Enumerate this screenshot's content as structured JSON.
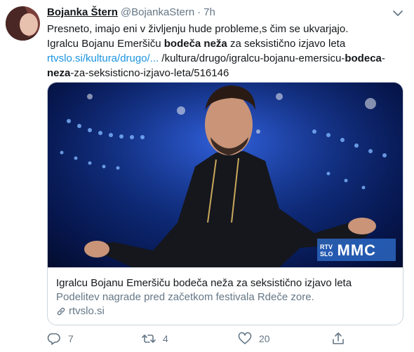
{
  "tweet": {
    "author_name": "Bojanka Štern",
    "author_handle": "@BojankaStern",
    "separator": "·",
    "time": "7h",
    "text_line1": "Presneto, imajo eni v življenju hude probleme,s čim se ukvarjajo.",
    "text_line2_pre": "Igralcu Bojanu Emeršiču ",
    "text_line2_bold": "bodeča neža",
    "text_line2_post": " za seksistično izjavo leta",
    "link_short": "rtvslo.si/kultura/drugo/...",
    "link_rest_pre": " /kultura/drugo/igralcu-bojanu-emersicu-",
    "link_rest_bold": "bodeca",
    "line4_bold": "neza",
    "line4_post": "-za-seksisticno-izjavo-leta/516146"
  },
  "card": {
    "title": "Igralcu Bojanu Emeršiču bodeča neža za seksistično izjavo leta",
    "description": "Podelitev nagrade pred začetkom festivala Rdeče zore.",
    "domain": "rtvslo.si",
    "watermark_rtv": "RTV",
    "watermark_slo": "SLO",
    "watermark_mmc": "MMC"
  },
  "actions": {
    "replies": "7",
    "retweets": "4",
    "likes": "20"
  },
  "colors": {
    "link": "#1b95e0",
    "secondary_text": "#657786",
    "primary_text": "#14171a"
  }
}
